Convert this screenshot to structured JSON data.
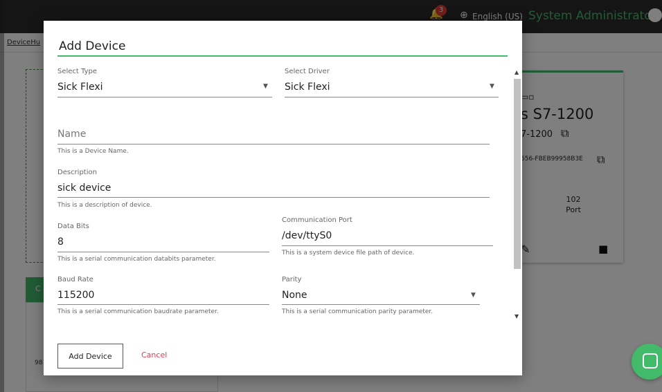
{
  "header": {
    "notification_count": "3",
    "language": "English (US)",
    "user": "System Administrator"
  },
  "breadcrumb": {
    "label": "DeviceHu"
  },
  "background": {
    "green_card_letter": "C",
    "bottom_card_text": "98",
    "device_card": {
      "name": "s S7-1200",
      "subtitle": "7-1200",
      "id": "556-FBEB99958B3E",
      "port_count": "102",
      "port_label": "Port"
    }
  },
  "dialog": {
    "title": "Add Device",
    "fields": {
      "type": {
        "label": "Select Type",
        "value": "Sick Flexi"
      },
      "driver": {
        "label": "Select Driver",
        "value": "Sick Flexi"
      },
      "name": {
        "placeholder": "Name",
        "helper": "This is a Device Name."
      },
      "description": {
        "label": "Description",
        "value": "sick device",
        "helper": "This is a description of device."
      },
      "data_bits": {
        "label": "Data Bits",
        "value": "8",
        "helper": "This is a serial communication databits parameter."
      },
      "comm_port": {
        "label": "Communication Port",
        "value": "/dev/ttyS0",
        "helper": "This is a system device file path of device."
      },
      "baud_rate": {
        "label": "Baud Rate",
        "value": "115200",
        "helper": "This is a serial communication baudrate parameter."
      },
      "parity": {
        "label": "Parity",
        "value": "None",
        "helper": "This is a serial communication parity parameter."
      }
    },
    "actions": {
      "add_label": "Add Device",
      "cancel_label": "Cancel"
    }
  },
  "colors": {
    "accent": "#43b96a",
    "cancel": "#e53950",
    "badge": "#e53935"
  },
  "icons": [
    "bell-icon",
    "globe-icon",
    "account-icon",
    "device-icon",
    "copy-icon",
    "edit-icon",
    "delete-icon",
    "chat-icon",
    "dropdown-caret-icon"
  ]
}
